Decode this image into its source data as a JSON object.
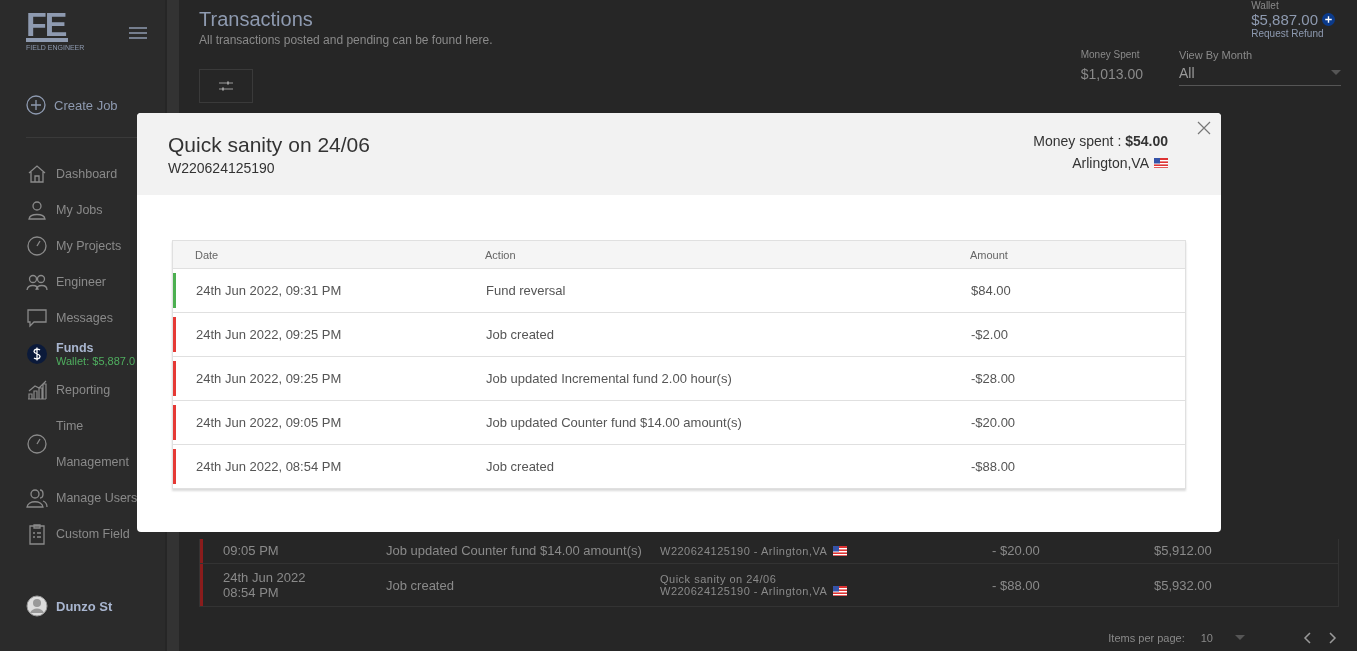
{
  "sidebar": {
    "logo": {
      "mark": "FE",
      "caption": "FIELD ENGINEER"
    },
    "create_job": "Create Job",
    "items": [
      {
        "label": "Dashboard",
        "selected": false
      },
      {
        "label": "My Jobs",
        "selected": false
      },
      {
        "label": "My Projects",
        "selected": false
      },
      {
        "label": "Engineer",
        "selected": false
      },
      {
        "label": "Messages",
        "selected": false
      },
      {
        "label": "Funds",
        "selected": true,
        "sub": "Wallet: $5,887.0"
      },
      {
        "label": "Reporting",
        "selected": false
      },
      {
        "label": "Time Management",
        "selected": false
      },
      {
        "label": "Manage Users",
        "selected": false
      },
      {
        "label": "Custom Field",
        "selected": false
      }
    ],
    "user": "Dunzo St"
  },
  "header": {
    "title": "Transactions",
    "subtitle": "All transactions posted and pending can be found here.",
    "wallet_label": "Wallet",
    "wallet_amount": "$5,887.00",
    "refund_link": "Request Refund",
    "money_spent_label": "Money Spent",
    "money_spent": "$1,013.00",
    "month_label": "View By Month",
    "month_value": "All"
  },
  "table": {
    "rows": [
      {
        "date_lines": [
          "09:05 PM"
        ],
        "action": "Job updated Counter fund $14.00 amount(s)",
        "job_lines": [
          "W220624125190 - Arlington,VA"
        ],
        "amount": "- $20.00",
        "balance": "$5,912.00",
        "color": "#8a1c1c"
      },
      {
        "date_lines": [
          "24th Jun 2022",
          "08:54 PM"
        ],
        "action": "Job created",
        "job_lines": [
          "Quick sanity on 24/06",
          "W220624125190 - Arlington,VA"
        ],
        "amount": "- $88.00",
        "balance": "$5,932.00",
        "color": "#8a1c1c"
      }
    ]
  },
  "pagination": {
    "label": "Items per page:",
    "value": "10"
  },
  "modal": {
    "title": "Quick sanity on 24/06",
    "job_id": "W220624125190",
    "money_spent_label": "Money spent :",
    "money_spent": "$54.00",
    "location": "Arlington,VA",
    "columns": [
      "Date",
      "Action",
      "Amount"
    ],
    "rows": [
      {
        "date": "24th Jun 2022, 09:31 PM",
        "action": "Fund reversal",
        "amount": "$84.00",
        "color": "#4caf50"
      },
      {
        "date": "24th Jun 2022, 09:25 PM",
        "action": "Job created",
        "amount": "-$2.00",
        "color": "#e53935"
      },
      {
        "date": "24th Jun 2022, 09:25 PM",
        "action": "Job updated Incremental fund 2.00 hour(s)",
        "amount": "-$28.00",
        "color": "#e53935"
      },
      {
        "date": "24th Jun 2022, 09:05 PM",
        "action": "Job updated Counter fund $14.00 amount(s)",
        "amount": "-$20.00",
        "color": "#e53935"
      },
      {
        "date": "24th Jun 2022, 08:54 PM",
        "action": "Job created",
        "amount": "-$88.00",
        "color": "#e53935"
      }
    ]
  }
}
